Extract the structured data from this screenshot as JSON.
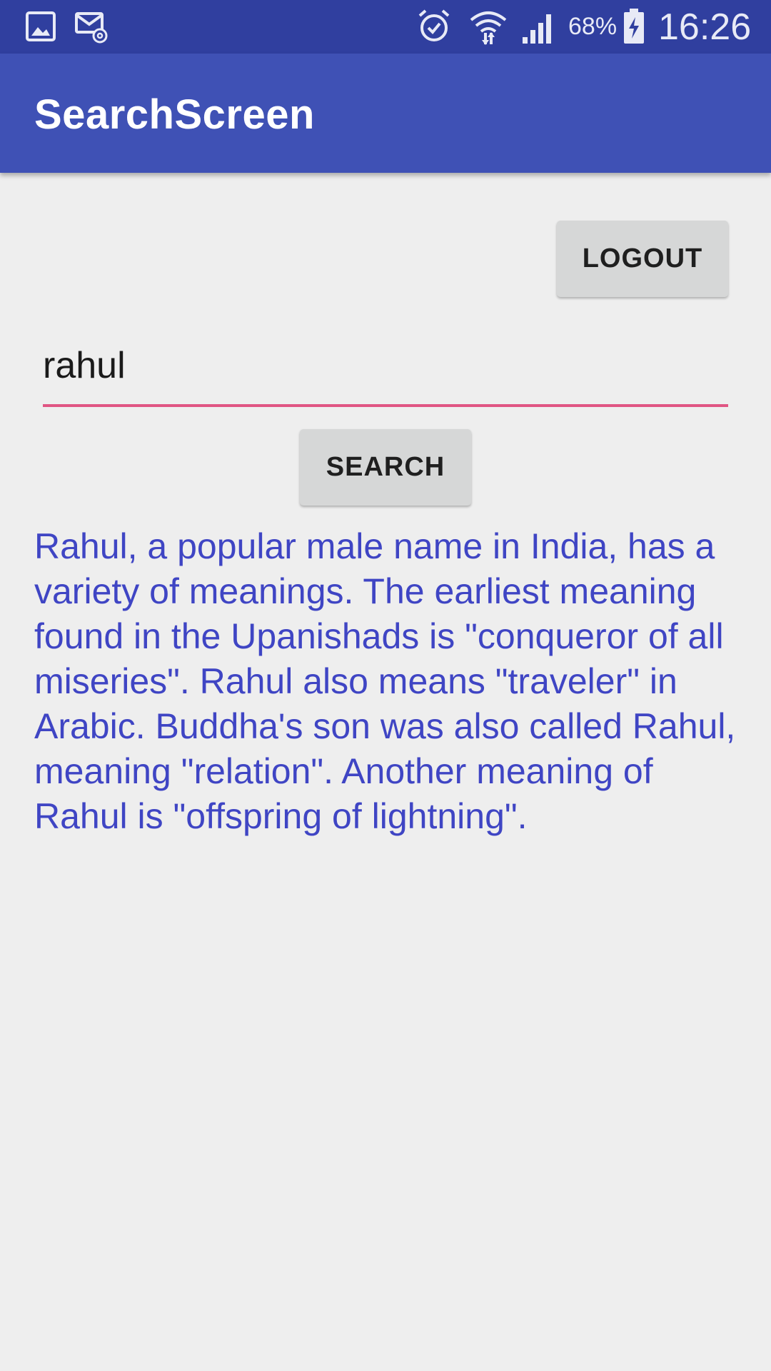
{
  "status_bar": {
    "battery": "68%",
    "time": "16:26",
    "icons": [
      "gallery-icon",
      "email-icon",
      "alarm-icon",
      "wifi-icon",
      "signal-icon",
      "battery-charging-icon"
    ]
  },
  "app_bar": {
    "title": "SearchScreen"
  },
  "actions": {
    "logout_label": "LOGOUT",
    "search_label": "SEARCH"
  },
  "search": {
    "value": "rahul"
  },
  "result": {
    "text": "Rahul, a popular male name in India, has a variety of meanings. The earliest meaning found in the Upanishads is \"conqueror of all miseries\". Rahul also means \"traveler\" in Arabic. Buddha's son was also called Rahul, meaning \"relation\". Another meaning of Rahul is \"offspring of lightning\"."
  },
  "colors": {
    "status_bar": "#303f9f",
    "app_bar": "#3f51b5",
    "accent": "#e05583",
    "result_text": "#3f45c4"
  }
}
